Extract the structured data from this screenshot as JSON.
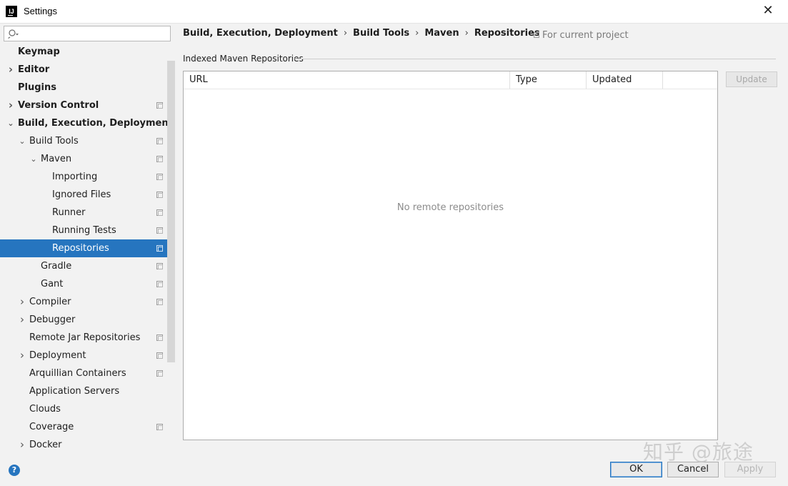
{
  "window": {
    "title": "Settings",
    "app_icon_text": "IJ",
    "close_glyph": "✕"
  },
  "search": {
    "placeholder": ""
  },
  "sidebar": {
    "items": [
      {
        "label": "Keymap",
        "level": 0,
        "bold": true,
        "arrow": "",
        "copy_icon": false,
        "selected": false
      },
      {
        "label": "Editor",
        "level": 0,
        "bold": true,
        "arrow": "›",
        "copy_icon": false,
        "selected": false
      },
      {
        "label": "Plugins",
        "level": 0,
        "bold": true,
        "arrow": "",
        "copy_icon": false,
        "selected": false
      },
      {
        "label": "Version Control",
        "level": 0,
        "bold": true,
        "arrow": "›",
        "copy_icon": true,
        "selected": false
      },
      {
        "label": "Build, Execution, Deployment",
        "level": 0,
        "bold": true,
        "arrow": "⌄",
        "copy_icon": false,
        "selected": false
      },
      {
        "label": "Build Tools",
        "level": 1,
        "bold": false,
        "arrow": "⌄",
        "copy_icon": true,
        "selected": false
      },
      {
        "label": "Maven",
        "level": 2,
        "bold": false,
        "arrow": "⌄",
        "copy_icon": true,
        "selected": false
      },
      {
        "label": "Importing",
        "level": 3,
        "bold": false,
        "arrow": "",
        "copy_icon": true,
        "selected": false
      },
      {
        "label": "Ignored Files",
        "level": 3,
        "bold": false,
        "arrow": "",
        "copy_icon": true,
        "selected": false
      },
      {
        "label": "Runner",
        "level": 3,
        "bold": false,
        "arrow": "",
        "copy_icon": true,
        "selected": false
      },
      {
        "label": "Running Tests",
        "level": 3,
        "bold": false,
        "arrow": "",
        "copy_icon": true,
        "selected": false
      },
      {
        "label": "Repositories",
        "level": 3,
        "bold": false,
        "arrow": "",
        "copy_icon": true,
        "selected": true
      },
      {
        "label": "Gradle",
        "level": 2,
        "bold": false,
        "arrow": "",
        "copy_icon": true,
        "selected": false
      },
      {
        "label": "Gant",
        "level": 2,
        "bold": false,
        "arrow": "",
        "copy_icon": true,
        "selected": false
      },
      {
        "label": "Compiler",
        "level": 1,
        "bold": false,
        "arrow": "›",
        "copy_icon": true,
        "selected": false
      },
      {
        "label": "Debugger",
        "level": 1,
        "bold": false,
        "arrow": "›",
        "copy_icon": false,
        "selected": false
      },
      {
        "label": "Remote Jar Repositories",
        "level": 1,
        "bold": false,
        "arrow": "",
        "copy_icon": true,
        "selected": false
      },
      {
        "label": "Deployment",
        "level": 1,
        "bold": false,
        "arrow": "›",
        "copy_icon": true,
        "selected": false
      },
      {
        "label": "Arquillian Containers",
        "level": 1,
        "bold": false,
        "arrow": "",
        "copy_icon": true,
        "selected": false
      },
      {
        "label": "Application Servers",
        "level": 1,
        "bold": false,
        "arrow": "",
        "copy_icon": false,
        "selected": false
      },
      {
        "label": "Clouds",
        "level": 1,
        "bold": false,
        "arrow": "",
        "copy_icon": false,
        "selected": false
      },
      {
        "label": "Coverage",
        "level": 1,
        "bold": false,
        "arrow": "",
        "copy_icon": true,
        "selected": false
      },
      {
        "label": "Docker",
        "level": 1,
        "bold": false,
        "arrow": "›",
        "copy_icon": false,
        "selected": false
      }
    ]
  },
  "main": {
    "breadcrumb": [
      "Build, Execution, Deployment",
      "Build Tools",
      "Maven",
      "Repositories"
    ],
    "breadcrumb_separator": "›",
    "scope": "For current project",
    "section_title": "Indexed Maven Repositories",
    "table": {
      "columns": [
        "URL",
        "Type",
        "Updated"
      ],
      "empty_message": "No remote repositories"
    },
    "update_label": "Update"
  },
  "footer": {
    "help_glyph": "?",
    "ok_label": "OK",
    "cancel_label": "Cancel",
    "apply_label": "Apply"
  },
  "watermark": "知乎 @旅途",
  "colors": {
    "accent": "#2675bf",
    "panel_bg": "#f2f2f2",
    "disabled_text": "#a8a8a8"
  }
}
